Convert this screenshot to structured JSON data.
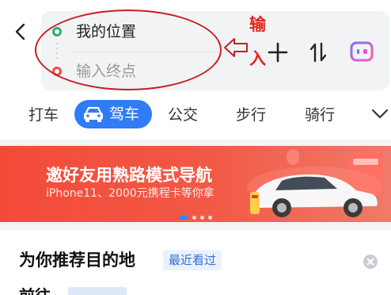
{
  "route": {
    "start_label": "我的位置",
    "end_placeholder": "输入终点"
  },
  "annotation": {
    "char_1": "输",
    "char_2": "入",
    "color": "#e2231a"
  },
  "tabs": [
    {
      "label": "打车",
      "active": false
    },
    {
      "label": "驾车",
      "active": true
    },
    {
      "label": "公交",
      "active": false
    },
    {
      "label": "步行",
      "active": false
    },
    {
      "label": "骑行",
      "active": false
    }
  ],
  "banner": {
    "title": "邀好友用熟路模式导航",
    "subtitle": "iPhone11、2000元携程卡等你拿",
    "page_count": 4,
    "active_page": 1
  },
  "recommend": {
    "title": "为你推荐目的地",
    "tag": "最近看过",
    "partial_prefix": "前往"
  },
  "colors": {
    "accent": "#2f7cf6",
    "start_dot": "#23b36b",
    "end_dot": "#f04a45",
    "banner": "#f34a38"
  },
  "icons": {
    "back": "chevron-left-icon",
    "add": "plus-icon",
    "swap": "swap-icon",
    "card": "card-icon",
    "car": "car-icon",
    "more": "chevron-down-icon",
    "close": "close-icon"
  }
}
